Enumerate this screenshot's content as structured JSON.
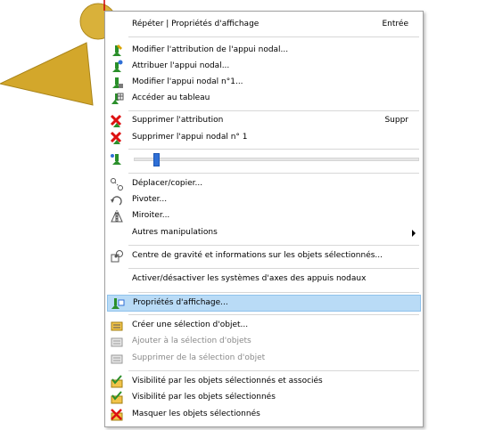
{
  "menu": {
    "repeat": {
      "label": "Répéter | Propriétés d'affichage",
      "shortcut": "Entrée"
    },
    "edit_assignment": {
      "label": "Modifier l'attribution de l'appui nodal..."
    },
    "assign_support": {
      "label": "Attribuer l'appui nodal..."
    },
    "edit_support": {
      "label": "Modifier l'appui nodal n°1..."
    },
    "go_to_table": {
      "label": "Accéder au tableau"
    },
    "delete_assignment": {
      "label": "Supprimer l'attribution",
      "shortcut": "Suppr"
    },
    "delete_support": {
      "label": "Supprimer l'appui nodal n° 1"
    },
    "move_copy": {
      "label": "Déplacer/copier..."
    },
    "rotate": {
      "label": "Pivoter..."
    },
    "mirror": {
      "label": "Miroiter..."
    },
    "other_manipulations": {
      "label": "Autres manipulations"
    },
    "centroid": {
      "label": "Centre de gravité et informations sur les objets sélectionnés..."
    },
    "toggle_axes": {
      "label": "Activer/désactiver les systèmes d'axes des appuis nodaux"
    },
    "display_properties": {
      "label": "Propriétés d'affichage..."
    },
    "create_selection": {
      "label": "Créer une sélection d'objet..."
    },
    "add_to_selection": {
      "label": "Ajouter à la sélection d'objets"
    },
    "remove_from_selection": {
      "label": "Supprimer de la sélection d'objet"
    },
    "visibility_selected_associated": {
      "label": "Visibilité par les objets sélectionnés et associés"
    },
    "visibility_selected": {
      "label": "Visibilité par les objets sélectionnés"
    },
    "hide_selected": {
      "label": "Masquer les objets sélectionnés"
    },
    "transparency_slider": {
      "value": 0.07
    }
  },
  "colors": {
    "highlight": "#b9dbf6",
    "support_shape": "#d4a92a",
    "disabled_text": "#8a8a8a"
  }
}
